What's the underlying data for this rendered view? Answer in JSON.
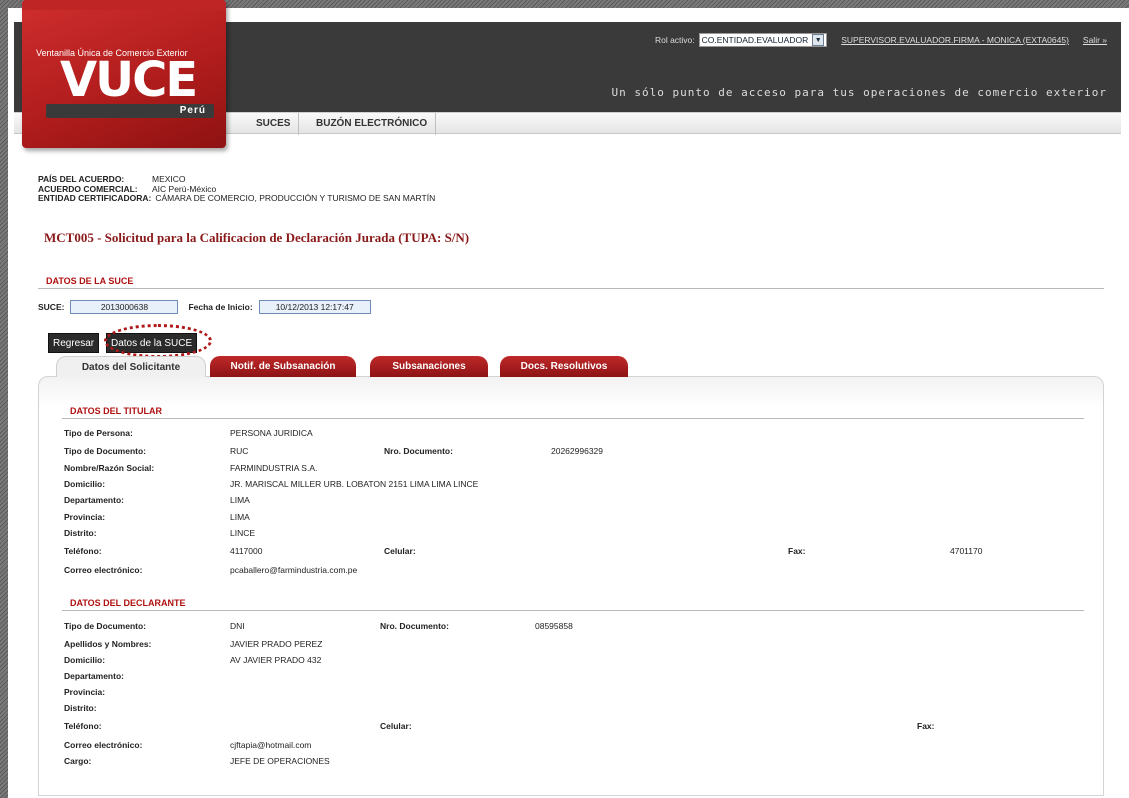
{
  "header": {
    "logo_text": "Ventanilla Única de Comercio Exterior",
    "logo_brand": "VUCE",
    "logo_country": "Perú",
    "slogan": "Un sólo punto de acceso para tus operaciones de comercio exterior",
    "rol_label": "Rol activo:",
    "rol_value": "CO.ENTIDAD.EVALUADOR",
    "user_link": "SUPERVISOR.EVALUADOR.FIRMA - MONICA (EXTA0645)",
    "logout_link": "Salir »"
  },
  "nav": {
    "items": [
      "SUCES",
      "BUZÓN ELECTRÓNICO"
    ]
  },
  "info": {
    "pais_label": "PAÍS DEL ACUERDO:",
    "pais_value": "MEXICO",
    "acuerdo_label": "ACUERDO COMERCIAL:",
    "acuerdo_value": "AIC Perú-México",
    "entidad_label": "ENTIDAD CERTIFICADORA:",
    "entidad_value": "CÁMARA DE COMERCIO, PRODUCCIÓN Y TURISMO DE SAN MARTÍN"
  },
  "title": "MCT005 - Solicitud para la Calificacion de Declaración Jurada (TUPA: S/N)",
  "suce_section": {
    "heading": "DATOS DE LA SUCE",
    "suce_label": "SUCE:",
    "suce_value": "2013000638",
    "fecha_label": "Fecha de Inicio:",
    "fecha_value": "10/12/2013 12:17:47"
  },
  "buttons": {
    "regresar": "Regresar",
    "datos_suce": "Datos de la SUCE"
  },
  "tabs": [
    "Datos del Solicitante",
    "Notif. de Subsanación",
    "Subsanaciones",
    "Docs. Resolutivos"
  ],
  "titular": {
    "heading": "DATOS DEL TITULAR",
    "tipo_persona_label": "Tipo de Persona:",
    "tipo_persona": "PERSONA JURIDICA",
    "tipo_doc_label": "Tipo de Documento:",
    "tipo_doc": "RUC",
    "nro_doc_label": "Nro. Documento:",
    "nro_doc": "20262996329",
    "nombre_label": "Nombre/Razón Social:",
    "nombre": "FARMINDUSTRIA S.A.",
    "domicilio_label": "Domicilio:",
    "domicilio": "JR. MARISCAL MILLER URB. LOBATON 2151 LIMA LIMA LINCE",
    "departamento_label": "Departamento:",
    "departamento": "LIMA",
    "provincia_label": "Provincia:",
    "provincia": "LIMA",
    "distrito_label": "Distrito:",
    "distrito": "LINCE",
    "telefono_label": "Teléfono:",
    "telefono": "4117000",
    "celular_label": "Celular:",
    "fax_label": "Fax:",
    "fax": "4701170",
    "correo_label": "Correo electrónico:",
    "correo": "pcaballero@farmindustria.com.pe"
  },
  "declarante": {
    "heading": "DATOS DEL DECLARANTE",
    "tipo_doc_label": "Tipo de Documento:",
    "tipo_doc": "DNI",
    "nro_doc_label": "Nro. Documento:",
    "nro_doc": "08595858",
    "nombres_label": "Apellidos y Nombres:",
    "nombres": "JAVIER PRADO PEREZ",
    "domicilio_label": "Domicilio:",
    "domicilio": "AV JAVIER PRADO 432",
    "departamento_label": "Departamento:",
    "provincia_label": "Provincia:",
    "distrito_label": "Distrito:",
    "telefono_label": "Teléfono:",
    "celular_label": "Celular:",
    "fax_label": "Fax:",
    "correo_label": "Correo electrónico:",
    "correo": "cjftapia@hotmail.com",
    "cargo_label": "Cargo:",
    "cargo": "JEFE DE OPERACIONES"
  }
}
